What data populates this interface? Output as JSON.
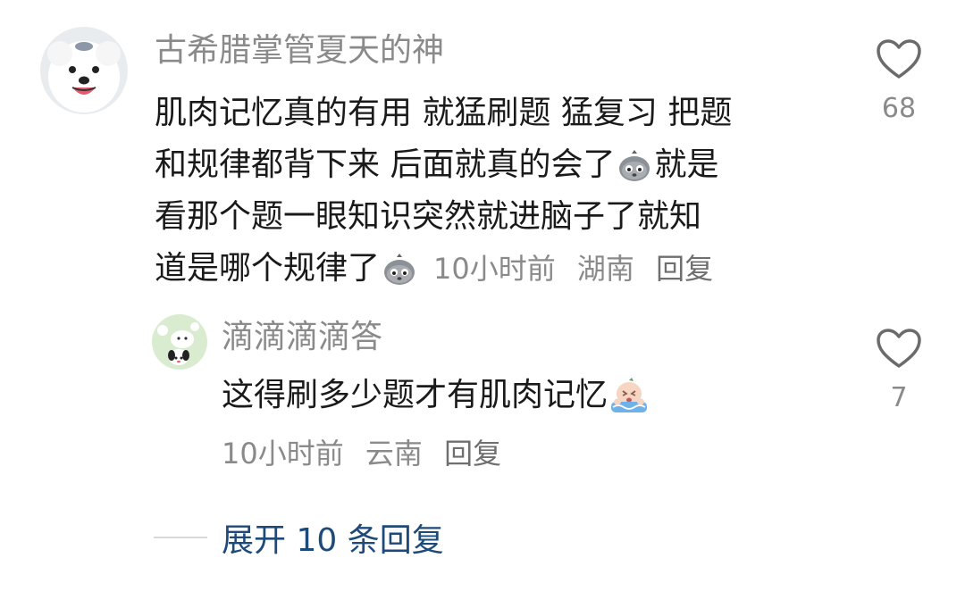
{
  "comment": {
    "username": "古希腊掌管夏天的神",
    "text_lines": [
      "肌肉记忆真的有用 就猛刷题 猛复习 把题",
      "和规律都背下来 后面就真的会了",
      "就是",
      "看那个题一眼知识突然就进脑子了就知",
      "道是哪个规律了"
    ],
    "time": "10小时前",
    "location": "湖南",
    "reply_label": "回复",
    "likes": "68"
  },
  "reply": {
    "username": "滴滴滴滴答",
    "text": "这得刷多少题才有肌肉记忆",
    "time": "10小时前",
    "location": "云南",
    "reply_label": "回复",
    "likes": "7"
  },
  "expand": {
    "label": "展开 10 条回复"
  },
  "colors": {
    "username": "#8a8a8a",
    "text": "#1a1a1a",
    "meta": "#8a8a8a",
    "link": "#1e4a7a"
  }
}
